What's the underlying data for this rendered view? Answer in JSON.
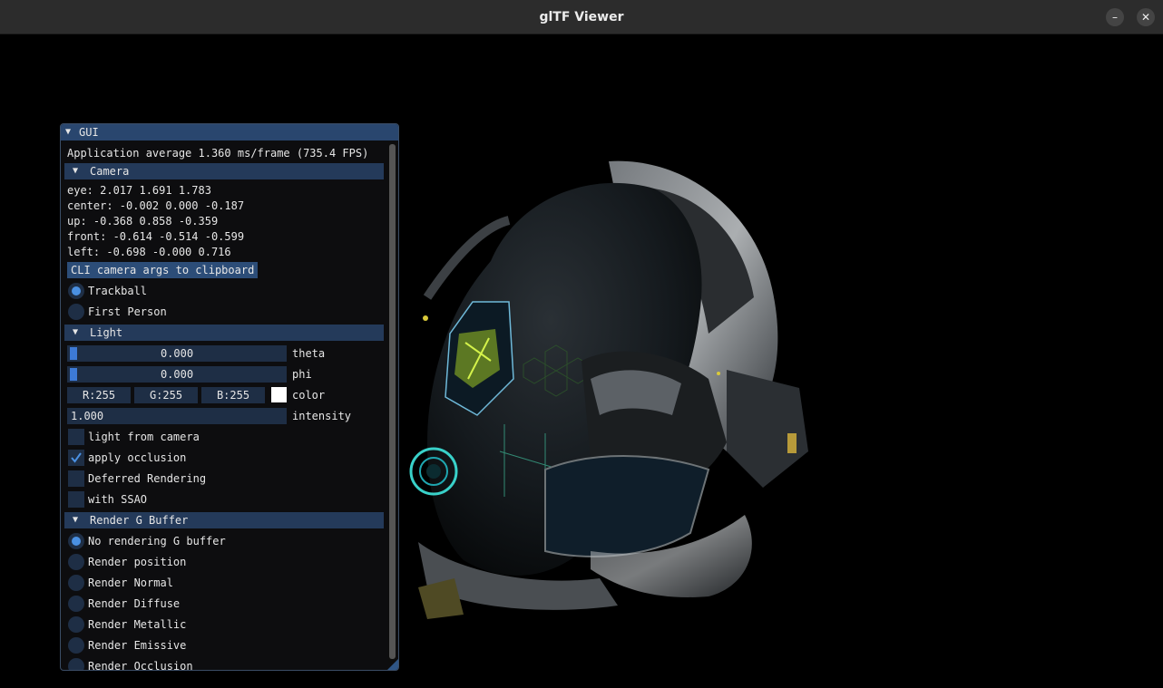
{
  "window": {
    "title": "glTF Viewer",
    "minimize_icon": "minimize-icon",
    "close_icon": "close-icon"
  },
  "gui": {
    "title": "GUI",
    "fps": "Application average 1.360 ms/frame (735.4 FPS)",
    "camera": {
      "header": "Camera",
      "eye": "eye: 2.017 1.691 1.783",
      "center": "center: -0.002 0.000 -0.187",
      "up": "up: -0.368 0.858 -0.359",
      "front": "front: -0.614 -0.514 -0.599",
      "left": "left: -0.698 -0.000 0.716",
      "clipboard_button": "CLI camera args to clipboard",
      "modes": [
        {
          "label": "Trackball",
          "selected": true
        },
        {
          "label": "First Person",
          "selected": false
        }
      ]
    },
    "light": {
      "header": "Light",
      "theta": {
        "value": "0.000",
        "label": "theta"
      },
      "phi": {
        "value": "0.000",
        "label": "phi"
      },
      "color": {
        "r": "R:255",
        "g": "G:255",
        "b": "B:255",
        "label": "color",
        "swatch": "#ffffff"
      },
      "intensity": {
        "value": "1.000",
        "label": "intensity"
      },
      "options": [
        {
          "label": "light from camera",
          "checked": false
        },
        {
          "label": "apply occlusion",
          "checked": true
        },
        {
          "label": "Deferred Rendering",
          "checked": false
        },
        {
          "label": "with SSAO",
          "checked": false
        }
      ]
    },
    "gbuffer": {
      "header": "Render G Buffer",
      "modes": [
        {
          "label": "No rendering G buffer",
          "selected": true
        },
        {
          "label": "Render position",
          "selected": false
        },
        {
          "label": "Render Normal",
          "selected": false
        },
        {
          "label": "Render Diffuse",
          "selected": false
        },
        {
          "label": "Render Metallic",
          "selected": false
        },
        {
          "label": "Render Emissive",
          "selected": false
        },
        {
          "label": "Render Occlusion",
          "selected": false
        }
      ]
    }
  },
  "colors": {
    "accent": "#4a90e2",
    "header": "#243a5a",
    "frame": "#1e2e45"
  }
}
